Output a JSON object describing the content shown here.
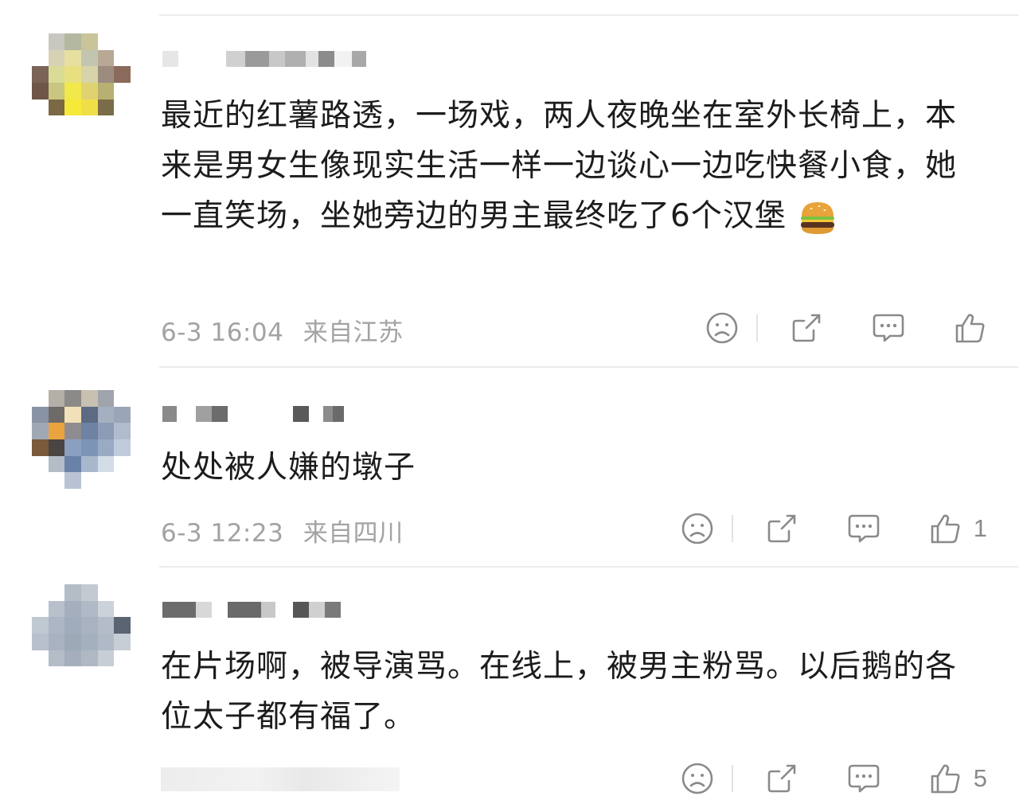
{
  "comments": [
    {
      "text": "最近的红薯路透，一场戏，两人夜晚坐在室外长椅上，本来是男女生像现实生活一样一边谈心一边吃快餐小食，她一直笑场，坐她旁边的男主最终吃了6个汉堡",
      "emoji": "hamburger",
      "time": "6-3 16:04",
      "location": "来自江苏",
      "likes": ""
    },
    {
      "text": "处处被人嫌的墩子",
      "time": "6-3 12:23",
      "location": "来自四川",
      "likes": "1"
    },
    {
      "text": "在片场啊，被导演骂。在线上，被男主粉骂。以后鹅的各位太子都有福了。",
      "time": "",
      "location": "",
      "likes": "5"
    }
  ],
  "icons": {
    "dislike": "sad-face-icon",
    "share": "share-icon",
    "reply": "comment-icon",
    "like": "thumbs-up-icon"
  },
  "colors": {
    "meta_text": "#a3a3a3",
    "icon": "#8a8a8a",
    "separator": "#ededed"
  }
}
